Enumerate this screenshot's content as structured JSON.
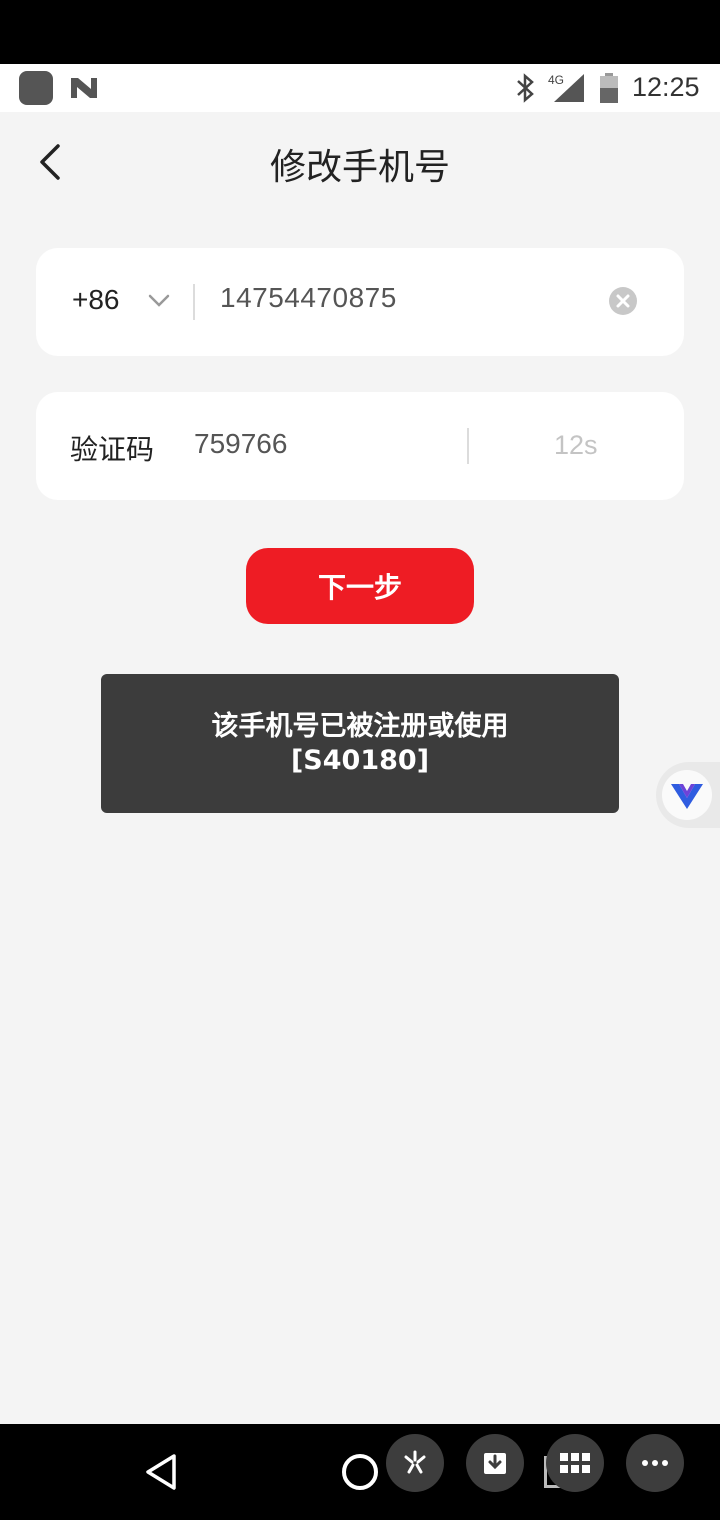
{
  "status_bar": {
    "time": "12:25",
    "network": "4G"
  },
  "header": {
    "title": "修改手机号"
  },
  "phone_form": {
    "country_code": "+86",
    "phone_value": "14754470875"
  },
  "code_form": {
    "label": "验证码",
    "code_value": "759766",
    "countdown": "12s"
  },
  "next_button": {
    "label": "下一步"
  },
  "toast": {
    "line1": "该手机号已被注册或使用",
    "line2": "[S40180]"
  },
  "colors": {
    "accent": "#ee1c24",
    "background": "#f4f4f4",
    "card": "#ffffff",
    "toast_bg": "#3c3c3c"
  },
  "icons": {
    "back": "chevron-left-icon",
    "dropdown": "chevron-down-icon",
    "clear": "clear-circle-icon",
    "floating_assistant": "v-logo-icon"
  }
}
